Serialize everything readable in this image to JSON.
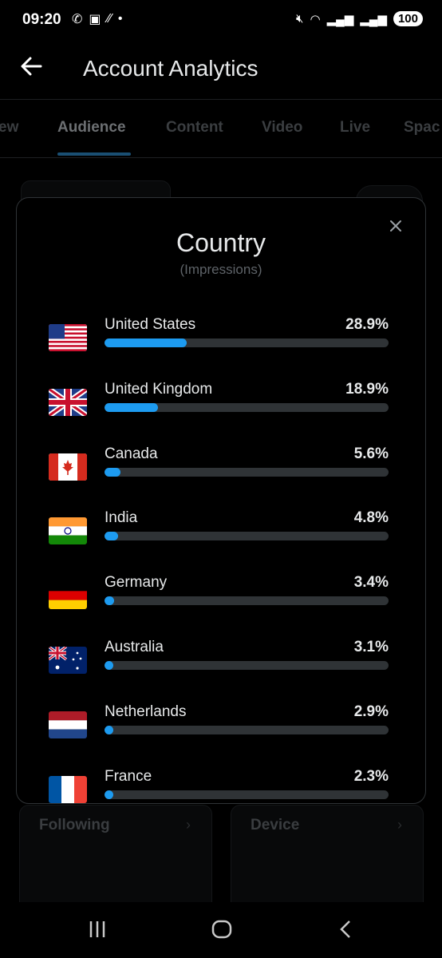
{
  "status": {
    "time": "09:20",
    "battery": "100"
  },
  "header": {
    "title": "Account Analytics"
  },
  "tabs": [
    {
      "label": "ew"
    },
    {
      "label": "Audience"
    },
    {
      "label": "Content"
    },
    {
      "label": "Video"
    },
    {
      "label": "Live"
    },
    {
      "label": "Spac"
    }
  ],
  "background_cards": {
    "following": "Following",
    "device": "Device"
  },
  "modal": {
    "title": "Country",
    "subtitle": "(Impressions)",
    "rows": [
      {
        "country": "United States",
        "percent": "28.9%",
        "value": 28.9,
        "flag": "us-flag"
      },
      {
        "country": "United Kingdom",
        "percent": "18.9%",
        "value": 18.9,
        "flag": "uk-flag"
      },
      {
        "country": "Canada",
        "percent": "5.6%",
        "value": 5.6,
        "flag": "canada-flag"
      },
      {
        "country": "India",
        "percent": "4.8%",
        "value": 4.8,
        "flag": "india-flag"
      },
      {
        "country": "Germany",
        "percent": "3.4%",
        "value": 3.4,
        "flag": "germany-flag"
      },
      {
        "country": "Australia",
        "percent": "3.1%",
        "value": 3.1,
        "flag": "australia-flag"
      },
      {
        "country": "Netherlands",
        "percent": "2.9%",
        "value": 2.9,
        "flag": "netherlands-flag"
      },
      {
        "country": "France",
        "percent": "2.3%",
        "value": 2.3,
        "flag": "france-flag"
      }
    ]
  },
  "colors": {
    "accent": "#1d9bf0",
    "track": "#2f3336",
    "background": "#000000"
  }
}
